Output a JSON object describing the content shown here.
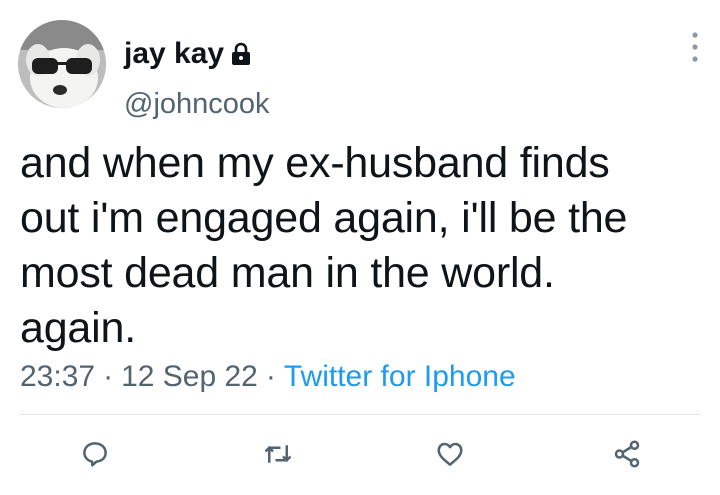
{
  "user": {
    "display_name": "jay kay",
    "handle": "@johncook",
    "avatar": "dog-with-sunglasses-avatar",
    "protected_icon": "lock-icon"
  },
  "tweet": {
    "text": "and when my ex-husband finds\nout i'm engaged again, i'll be the\nmost dead man in the world.\nagain."
  },
  "meta": {
    "time": "23:37",
    "separator": "·",
    "date": "12 Sep 22",
    "source": "Twitter for Iphone"
  },
  "actions": [
    {
      "name": "reply",
      "icon": "reply-icon"
    },
    {
      "name": "retweet",
      "icon": "retweet-icon"
    },
    {
      "name": "like",
      "icon": "heart-icon"
    },
    {
      "name": "share",
      "icon": "share-icon"
    }
  ],
  "colors": {
    "text": "#0f1419",
    "secondary": "#536471",
    "link": "#1d9bf0",
    "divider": "#e5e8ea"
  }
}
